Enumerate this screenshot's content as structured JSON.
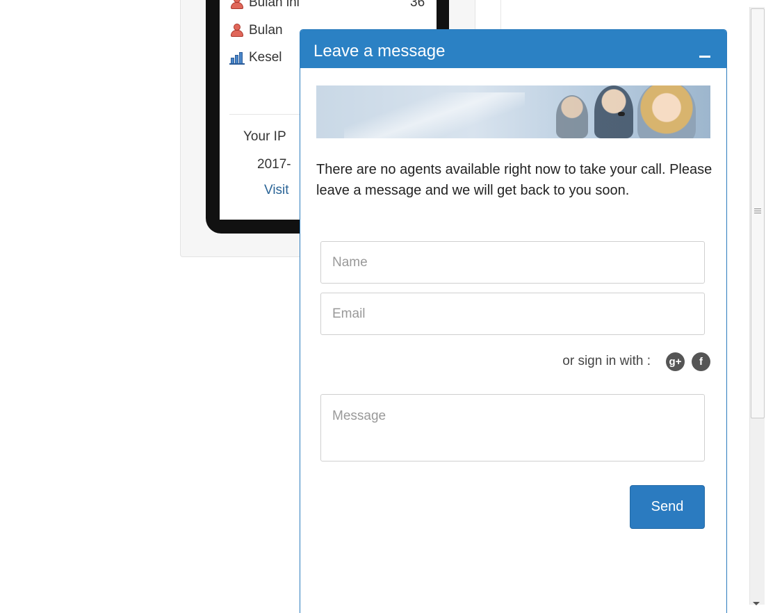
{
  "background": {
    "stats": [
      {
        "label": "Bulan ini",
        "value": "36",
        "icon": "user-red-icon"
      },
      {
        "label": "Bulan",
        "value": "",
        "icon": "user-red-icon"
      },
      {
        "label": "Kesel",
        "value": "",
        "icon": "bar-chart-icon"
      }
    ],
    "ip_label": "Your IP",
    "date_text": "2017-",
    "visit_link": "Visit"
  },
  "chat": {
    "title": "Leave a message",
    "minimize_icon": "minus-icon",
    "intro": "There are no agents available right now to take your call. Please leave a message and we will get back to you soon.",
    "name_placeholder": "Name",
    "email_placeholder": "Email",
    "signin_label": "or sign in with :",
    "social": [
      {
        "icon": "google-plus-icon",
        "glyph": "g+"
      },
      {
        "icon": "facebook-icon",
        "glyph": "f"
      }
    ],
    "message_placeholder": "Message",
    "send_label": "Send",
    "accent_color": "#2b81c4"
  }
}
